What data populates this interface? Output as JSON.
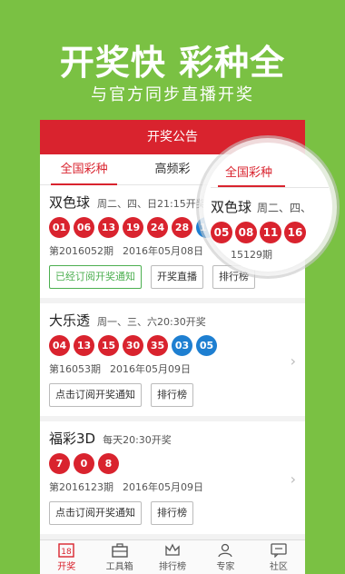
{
  "promo": {
    "headline": "开奖快  彩种全",
    "subline": "与官方同步直播开奖"
  },
  "header": {
    "title": "开奖公告"
  },
  "tabs": [
    {
      "label": "全国彩种",
      "active": true
    },
    {
      "label": "高频彩",
      "active": false
    },
    {
      "label": "",
      "active": false
    }
  ],
  "lotteries": [
    {
      "name": "双色球",
      "schedule": "周二、四、日21:15开奖",
      "red_balls": [
        "01",
        "06",
        "13",
        "19",
        "24",
        "28"
      ],
      "blue_balls": [
        "16"
      ],
      "issue": "第2016052期",
      "date": "2016年05月08日",
      "buttons": [
        "已经订阅开奖通知",
        "开奖直播",
        "排行榜"
      ]
    },
    {
      "name": "大乐透",
      "schedule": "周一、三、六20:30开奖",
      "red_balls": [
        "04",
        "13",
        "15",
        "30",
        "35"
      ],
      "blue_balls": [
        "03",
        "05"
      ],
      "issue": "第16053期",
      "date": "2016年05月09日",
      "buttons": [
        "点击订阅开奖通知",
        "排行榜"
      ]
    },
    {
      "name": "福彩3D",
      "schedule": "每天20:30开奖",
      "red_balls": [
        "7",
        "0",
        "8"
      ],
      "blue_balls": [],
      "issue": "第2016123期",
      "date": "2016年05月09日",
      "buttons": [
        "点击订阅开奖通知",
        "排行榜"
      ]
    }
  ],
  "magnifier": {
    "tab": "全国彩种",
    "name": "双色球",
    "schedule": "周二、四、",
    "balls": [
      "05",
      "08",
      "11",
      "16"
    ],
    "meta": "15129期"
  },
  "bottom_nav": [
    {
      "label": "开奖",
      "icon": "calendar-18-icon",
      "active": true
    },
    {
      "label": "工具箱",
      "icon": "toolbox-icon",
      "active": false
    },
    {
      "label": "排行榜",
      "icon": "crown-icon",
      "active": false
    },
    {
      "label": "专家",
      "icon": "person-icon",
      "active": false
    },
    {
      "label": "社区",
      "icon": "chat-icon",
      "active": false
    }
  ],
  "colors": {
    "background": "#7ac143",
    "accent": "#d9232e",
    "blue_ball": "#1e7fd1"
  }
}
